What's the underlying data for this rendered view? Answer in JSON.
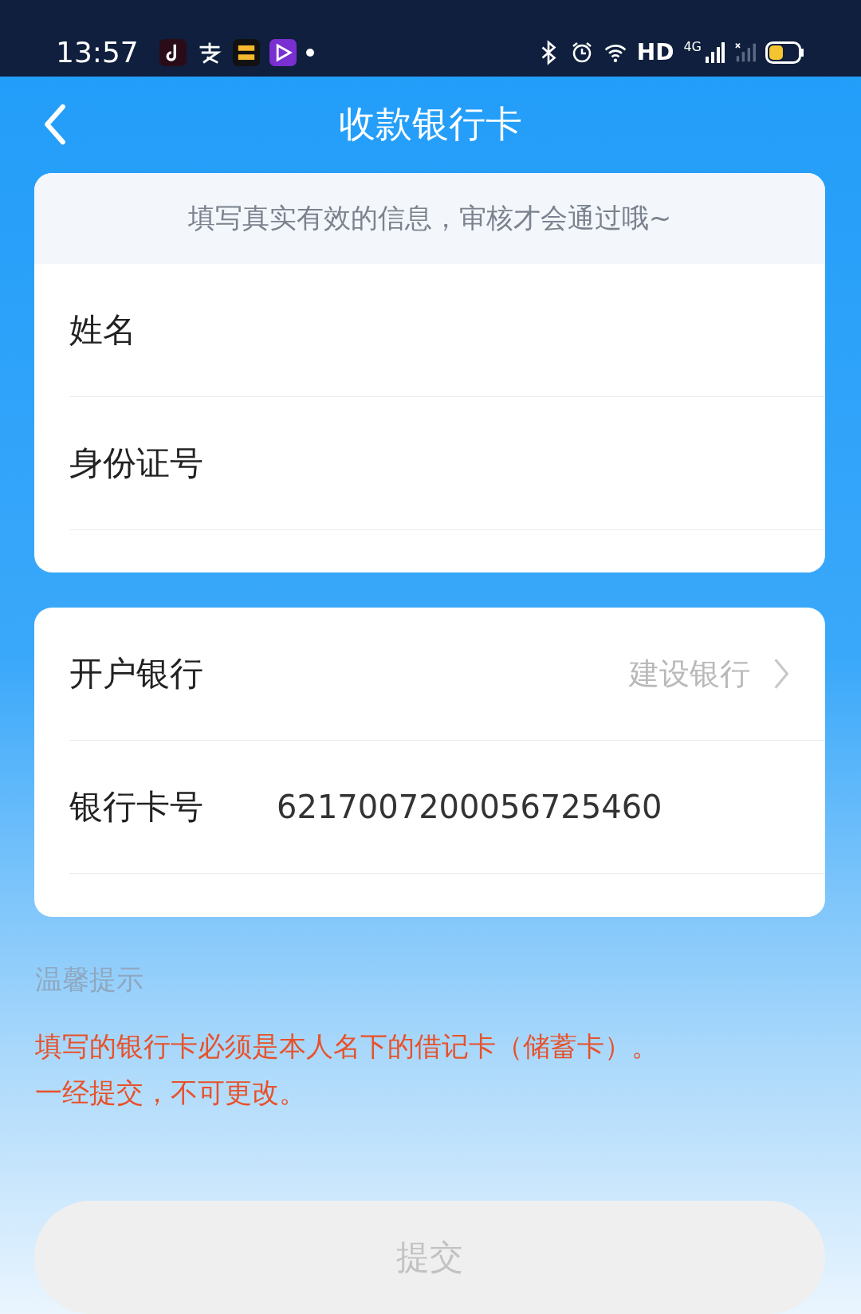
{
  "status_bar": {
    "time": "13:57",
    "hd": "HD",
    "network": "4G"
  },
  "header": {
    "title": "收款银行卡"
  },
  "card_hint": "填写真实有效的信息，审核才会通过哦~",
  "personal_fields": [
    {
      "label": "姓名"
    },
    {
      "label": "身份证号"
    }
  ],
  "bank_fields": [
    {
      "kind": "select",
      "label": "开户银行",
      "value": "建设银行"
    },
    {
      "kind": "input",
      "label": "银行卡号",
      "value": "6217007200056725460"
    }
  ],
  "tips": {
    "title": "温馨提示",
    "lines": [
      "填写的银行卡必须是本人名下的借记卡（储蓄卡）。",
      "一经提交，不可更改。"
    ]
  },
  "submit": {
    "label": "提交",
    "disabled": true
  }
}
